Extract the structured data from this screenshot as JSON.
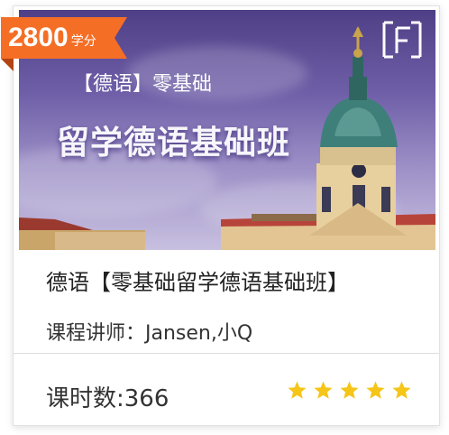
{
  "badge": {
    "value": "2800",
    "unit": "学分"
  },
  "banner": {
    "subtitle": "【德语】零基础",
    "title": "留学德语基础班",
    "logo_icon": "brand-logo-icon"
  },
  "course": {
    "title": "德语【零基础留学德语基础班】",
    "teacher": "课程讲师：Jansen,小Q",
    "hours": "课时数:366"
  },
  "rating": {
    "stars": 5,
    "max": 5,
    "color": "#f5c518"
  },
  "colors": {
    "badge": "#f56e25",
    "banner_sky": "#6f5fa8"
  }
}
